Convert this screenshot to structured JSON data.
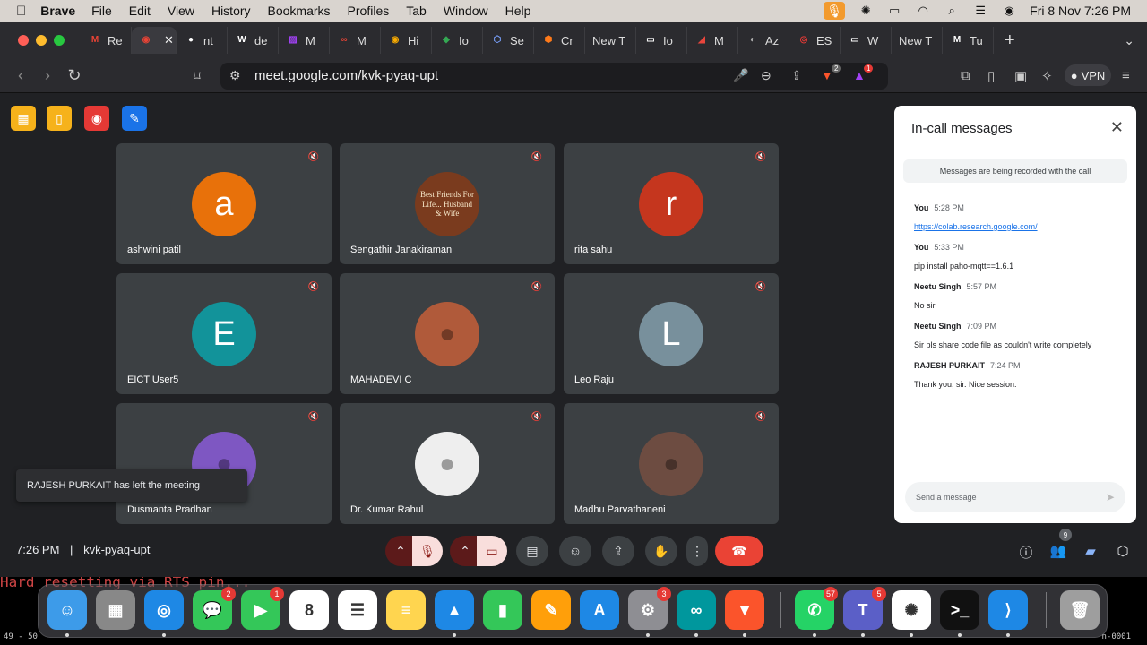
{
  "menubar": {
    "app": "Brave",
    "items": [
      "File",
      "Edit",
      "View",
      "History",
      "Bookmarks",
      "Profiles",
      "Tab",
      "Window",
      "Help"
    ],
    "datetime": "Fri 8 Nov  7:26 PM"
  },
  "tabs": [
    {
      "label": "Re",
      "color": "#ea4335",
      "glyph": "M"
    },
    {
      "label": "",
      "color": "#ea4335",
      "glyph": "◉",
      "active": true
    },
    {
      "label": "nt",
      "color": "#ffffff",
      "glyph": "●"
    },
    {
      "label": "de",
      "color": "#ffffff",
      "glyph": "W"
    },
    {
      "label": "M",
      "color": "#a142f4",
      "glyph": "▨"
    },
    {
      "label": "M",
      "color": "#ea4335",
      "glyph": "∞"
    },
    {
      "label": "Hi",
      "color": "#f9ab00",
      "glyph": "◉"
    },
    {
      "label": "Io",
      "color": "#34a853",
      "glyph": "◆"
    },
    {
      "label": "Se",
      "color": "#7aa2ff",
      "glyph": "⬡"
    },
    {
      "label": "Cr",
      "color": "#ff7a1a",
      "glyph": "⬢"
    },
    {
      "label": "New T",
      "color": "",
      "glyph": ""
    },
    {
      "label": "Io",
      "color": "#ffffff",
      "glyph": "▭"
    },
    {
      "label": "M",
      "color": "#e8453c",
      "glyph": "◢"
    },
    {
      "label": "Az",
      "color": "#aaaaaa",
      "glyph": "◐"
    },
    {
      "label": "ES",
      "color": "#e53935",
      "glyph": "◎"
    },
    {
      "label": "W",
      "color": "#ffffff",
      "glyph": "▭"
    },
    {
      "label": "New T",
      "color": "",
      "glyph": ""
    },
    {
      "label": "Tu",
      "color": "#ffffff",
      "glyph": "M"
    }
  ],
  "toolbar": {
    "url": "meet.google.com/kvk-pyaq-upt",
    "vpn": "VPN",
    "brave_shield_count": "2",
    "rewards_count": "1"
  },
  "participants": [
    {
      "name": "ashwini patil",
      "initial": "a",
      "bg": "#e8710a"
    },
    {
      "name": "Sengathir Janakiraman",
      "initial": "",
      "bg": "#7a3b1e",
      "photo_text": "Best Friends For Life... Husband & Wife"
    },
    {
      "name": "rita sahu",
      "initial": "r",
      "bg": "#c5361e"
    },
    {
      "name": "EICT User5",
      "initial": "E",
      "bg": "#12939a"
    },
    {
      "name": "MAHADEVI C",
      "initial": "",
      "bg": "#b05a3a"
    },
    {
      "name": "Leo Raju",
      "initial": "L",
      "bg": "#78909c"
    },
    {
      "name": "Dusmanta Pradhan",
      "initial": "",
      "bg": "#7e57c2"
    },
    {
      "name": "Dr. Kumar Rahul",
      "initial": "",
      "bg": "#eeeeee"
    },
    {
      "name": "Madhu Parvathaneni",
      "initial": "",
      "bg": "#6d4c41"
    }
  ],
  "toast": "RAJESH PURKAIT has left the meeting",
  "panel": {
    "title": "In-call messages",
    "notice": "Messages are being recorded with the call",
    "messages": [
      {
        "sender": "You",
        "time": "5:28 PM",
        "text": "https://colab.research.google.com/",
        "link": true
      },
      {
        "sender": "You",
        "time": "5:33 PM",
        "text": "pip install paho-mqtt==1.6.1"
      },
      {
        "sender": "Neetu Singh",
        "time": "5:57 PM",
        "text": "No sir"
      },
      {
        "sender": "Neetu Singh",
        "time": "7:09 PM",
        "text": "Sir pls share code file as couldn't write completely"
      },
      {
        "sender": "RAJESH PURKAIT",
        "time": "7:24 PM",
        "text": "Thank you, sir. Nice session."
      }
    ],
    "input_placeholder": "Send a message"
  },
  "bottombar": {
    "time": "7:26 PM",
    "sep": "|",
    "code": "kvk-pyaq-upt",
    "people_count": "9"
  },
  "terminal": {
    "text": "Hard resetting via RTS pin...",
    "left": "49 - 50",
    "right": "n-0001"
  },
  "dock": [
    {
      "name": "Finder",
      "color": "#3d9be9",
      "glyph": "☺",
      "dot": true
    },
    {
      "name": "Launchpad",
      "color": "#888888",
      "glyph": "▦",
      "dot": false
    },
    {
      "name": "Safari",
      "color": "#1e88e5",
      "glyph": "◎",
      "dot": true
    },
    {
      "name": "Messages",
      "color": "#34c759",
      "glyph": "💬",
      "badge": "2",
      "dot": false
    },
    {
      "name": "FaceTime",
      "color": "#34c759",
      "glyph": "▶",
      "badge": "1",
      "dot": false
    },
    {
      "name": "Calendar",
      "color": "#ffffff",
      "glyph": "8",
      "dot": false
    },
    {
      "name": "Reminders",
      "color": "#ffffff",
      "glyph": "☰",
      "dot": false
    },
    {
      "name": "Notes",
      "color": "#ffd54f",
      "glyph": "≡",
      "dot": false
    },
    {
      "name": "Keynote",
      "color": "#1e88e5",
      "glyph": "▲",
      "dot": true
    },
    {
      "name": "Numbers",
      "color": "#34c759",
      "glyph": "▮",
      "dot": false
    },
    {
      "name": "Pages",
      "color": "#ff9f0a",
      "glyph": "✎",
      "dot": false
    },
    {
      "name": "App Store",
      "color": "#1e88e5",
      "glyph": "A",
      "dot": false
    },
    {
      "name": "System Settings",
      "color": "#8e8e93",
      "glyph": "⚙",
      "badge": "3",
      "dot": true
    },
    {
      "name": "Arduino",
      "color": "#00979d",
      "glyph": "∞",
      "dot": true
    },
    {
      "name": "Brave",
      "color": "#fb542b",
      "glyph": "▼",
      "dot": true
    },
    {
      "name": "WhatsApp",
      "color": "#25d366",
      "glyph": "✆",
      "badge": "57",
      "dot": true
    },
    {
      "name": "Teams",
      "color": "#5b5fc7",
      "glyph": "T",
      "badge": "5",
      "dot": true
    },
    {
      "name": "ChatGPT",
      "color": "#ffffff",
      "glyph": "✺",
      "dot": true
    },
    {
      "name": "Terminal",
      "color": "#111111",
      "glyph": ">_",
      "dot": true
    },
    {
      "name": "VS Code",
      "color": "#1e88e5",
      "glyph": "⟩",
      "dot": true
    },
    {
      "name": "Trash",
      "color": "#9e9e9e",
      "glyph": "🗑",
      "dot": false
    }
  ]
}
